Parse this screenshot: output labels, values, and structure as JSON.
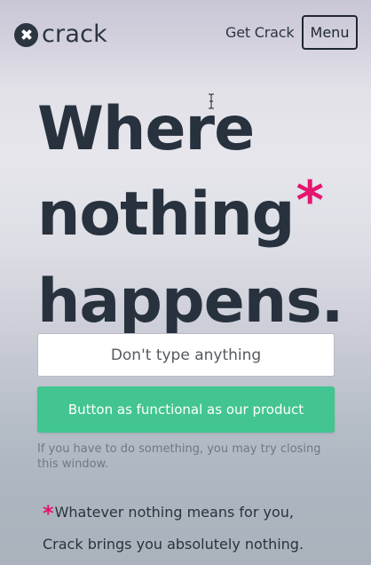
{
  "header": {
    "logo_text": "crack",
    "get_crack_label": "Get Crack",
    "menu_label": "Menu"
  },
  "hero": {
    "line1": "Where",
    "line2": "nothing",
    "asterisk": "*",
    "line3": "happens."
  },
  "form": {
    "input_placeholder": "Don't type anything",
    "input_value": "",
    "button_label": "Button as functional as our product",
    "helper_text": "If you have to do something, you may try closing this window."
  },
  "footnote": {
    "asterisk": "*",
    "line1": "Whatever nothing means for you,",
    "line2": "Crack brings you absolutely nothing."
  },
  "colors": {
    "accent_pink": "#e4166f",
    "button_green": "#42c590",
    "text_dark": "#27323e"
  },
  "icons": {
    "logo": "close-circle-icon",
    "cursor": "text-cursor-icon"
  }
}
